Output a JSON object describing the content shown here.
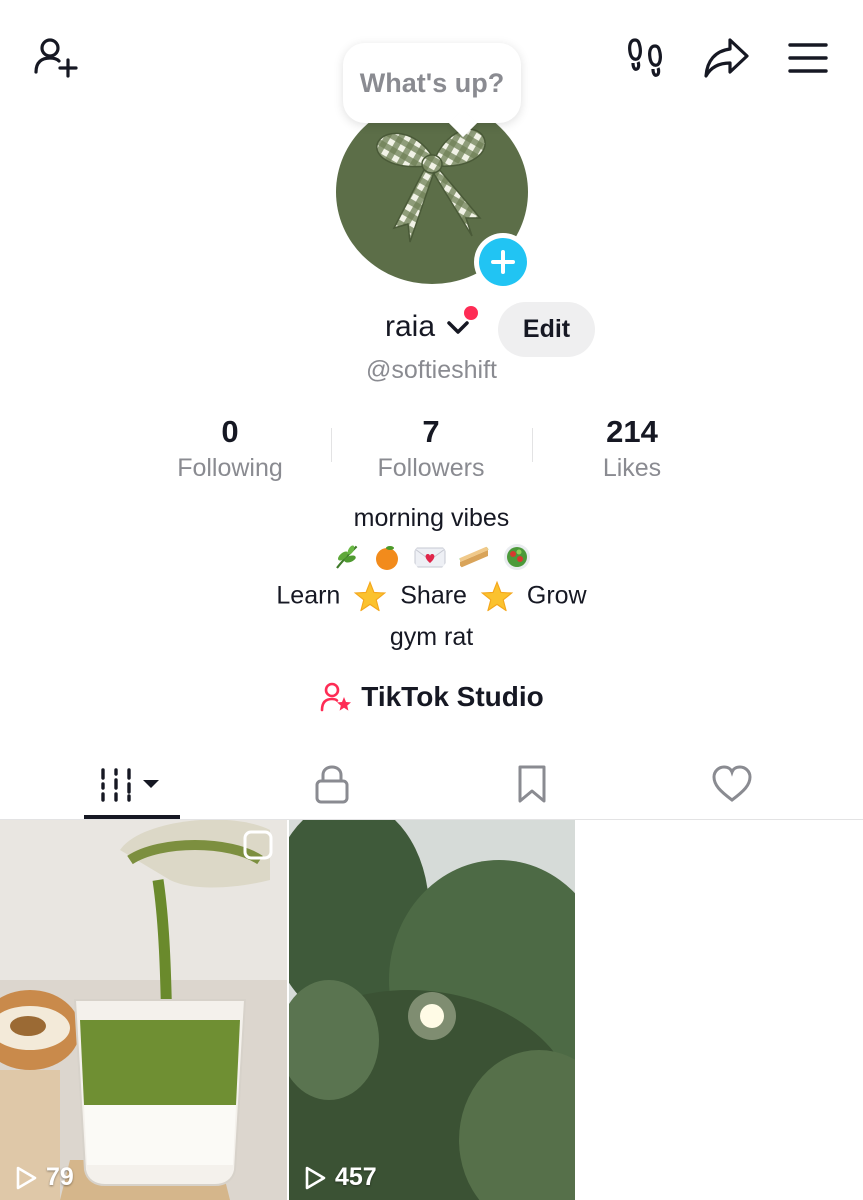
{
  "header": {
    "status_bubble": "What's up?"
  },
  "profile": {
    "name": "raia",
    "edit_label": "Edit",
    "handle": "@softieshift"
  },
  "stats": [
    {
      "value": "0",
      "label": "Following"
    },
    {
      "value": "7",
      "label": "Followers"
    },
    {
      "value": "214",
      "label": "Likes"
    }
  ],
  "bio": {
    "line1": "morning vibes",
    "emoji_row": [
      "herb",
      "orange",
      "love-letter",
      "sandwich",
      "salad"
    ],
    "learn": "Learn",
    "share": "Share",
    "grow": "Grow",
    "line4": "gym rat"
  },
  "studio_label": "TikTok Studio",
  "tabs": [
    "videos",
    "private",
    "saved",
    "liked"
  ],
  "videos": [
    {
      "views": "79",
      "subject": "matcha latte pour"
    },
    {
      "views": "457",
      "subject": "olive tree and sky"
    }
  ],
  "colors": {
    "accent": "#fe2c55",
    "add_button": "#21c4f3",
    "avatar_bg": "#5c6e48",
    "secondary_text": "#8a8b91"
  }
}
